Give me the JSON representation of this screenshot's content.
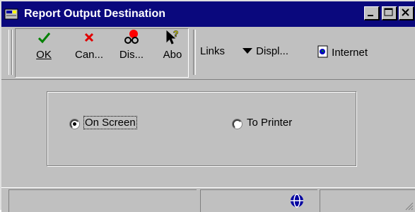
{
  "window": {
    "title": "Report Output Destination",
    "controls": [
      "minimize",
      "maximize",
      "close"
    ]
  },
  "toolbar": {
    "buttons": [
      {
        "label": "OK",
        "icon": "checkmark-icon",
        "color": "#008000"
      },
      {
        "label": "Can...",
        "icon": "x-icon",
        "color": "#e00000"
      },
      {
        "label": "Dis...",
        "icon": "glasses-icon",
        "color": "#ff0000"
      },
      {
        "label": "Abo",
        "icon": "help-pointer-icon",
        "color": "#ffff00"
      }
    ],
    "links": [
      {
        "label": "Links",
        "icon": null
      },
      {
        "label": "Displ...",
        "icon": "triangle-down-icon"
      },
      {
        "label": "Internet",
        "icon": "page-icon"
      }
    ]
  },
  "options": {
    "on_screen": {
      "label": "On Screen",
      "selected": true
    },
    "to_printer": {
      "label": "To Printer",
      "selected": false
    }
  },
  "statusbar": {
    "icon": "globe-icon"
  }
}
